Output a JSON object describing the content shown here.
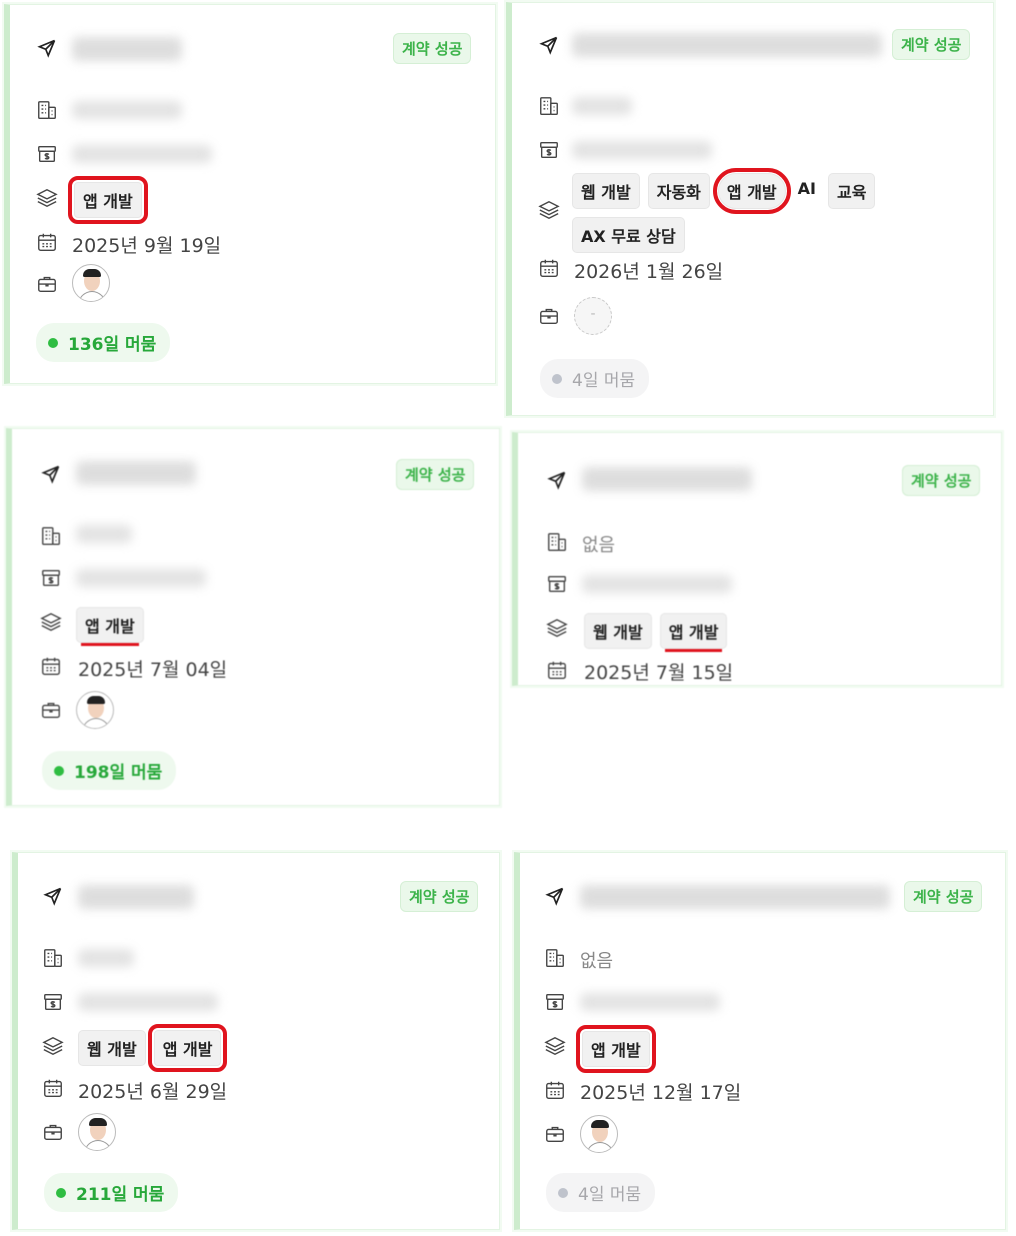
{
  "status_label": "계약 성공",
  "cards": [
    {
      "tags": [
        "앱 개발"
      ],
      "date": "2025년 9월 19일",
      "stay": "136일 머뭄"
    },
    {
      "tags": [
        "웹 개발",
        "자동화",
        "앱 개발",
        "AI",
        "교육",
        "AX 무료 상담"
      ],
      "date": "2026년 1월 26일",
      "manager_empty": "-",
      "stay": "4일 머뭄"
    },
    {
      "tags": [
        "앱 개발"
      ],
      "date": "2025년 7월 04일",
      "stay": "198일 머뭄"
    },
    {
      "company": "없음",
      "tags": [
        "웹 개발",
        "앱 개발"
      ],
      "date": "2025년 7월 15일"
    },
    {
      "tags": [
        "웹 개발",
        "앱 개발"
      ],
      "date": "2025년 6월 29일",
      "stay": "211일 머뭄"
    },
    {
      "company": "없음",
      "tags": [
        "앱 개발"
      ],
      "date": "2025년 12월 17일",
      "stay": "4일 머뭄"
    }
  ],
  "icons": [
    "send-icon",
    "building-icon",
    "money-box-icon",
    "layers-icon",
    "calendar-icon",
    "briefcase-icon"
  ],
  "colors": {
    "success_green": "#3cb34a",
    "highlight_red": "#e0141e"
  }
}
